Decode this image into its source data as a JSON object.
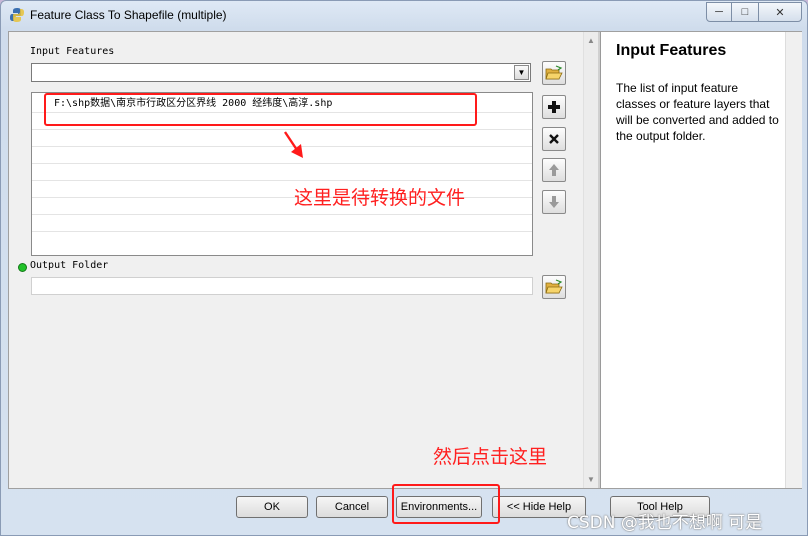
{
  "window": {
    "title": "Feature Class To Shapefile (multiple)",
    "buttons": [
      "─",
      "□",
      "✕"
    ]
  },
  "form": {
    "input_features_label": "Input Features",
    "input_features_combo_value": "",
    "input_list": [
      "F:\\shp数据\\南京市行政区分区界线  2000  经纬度\\高淳.shp",
      "",
      "",
      "",
      "",
      "",
      "",
      "",
      ""
    ],
    "output_folder_label": "Output Folder",
    "output_folder_value": ""
  },
  "help": {
    "title": "Input Features",
    "description": "The list of input feature classes or feature layers that will be converted and added to the output folder."
  },
  "annotations": {
    "file_note": "这里是待转换的文件",
    "click_note": "然后点击这里",
    "color": "#ff1a1a"
  },
  "footer": {
    "ok": "OK",
    "cancel": "Cancel",
    "environments": "Environments...",
    "hide_help": "<< Hide Help",
    "tool_help": "Tool Help"
  },
  "watermark": "CSDN @我也不想啊 可是",
  "icons": {
    "title": "python-tool-icon",
    "browse": "open-folder-icon",
    "add": "plus-icon",
    "remove": "x-icon",
    "up": "arrow-up-icon",
    "down": "arrow-down-icon"
  }
}
